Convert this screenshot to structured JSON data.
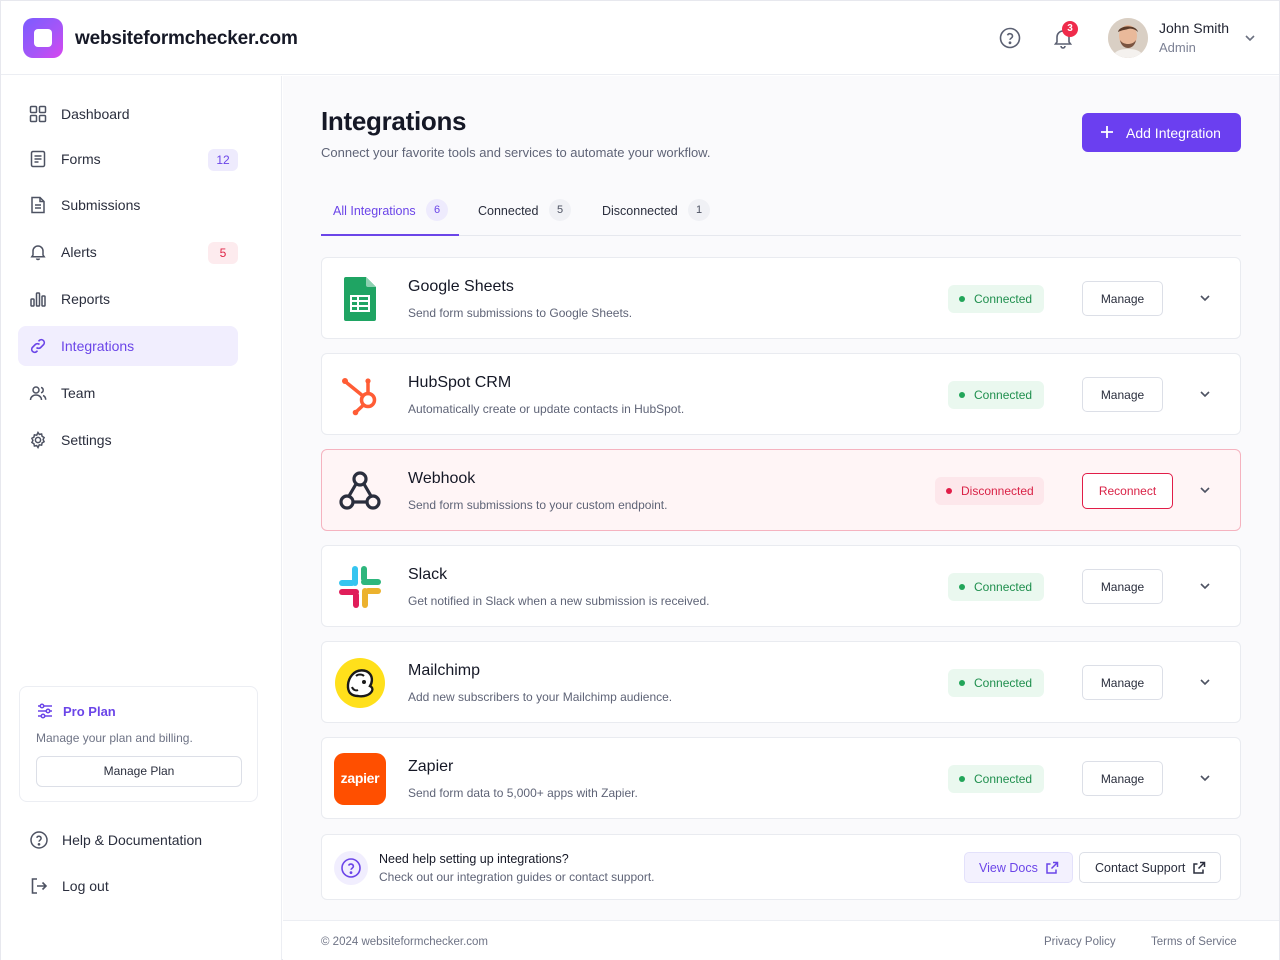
{
  "header": {
    "brand": "websiteformchecker.com",
    "notifications_count": "3",
    "user_name": "John Smith",
    "user_role": "Admin"
  },
  "sidebar": {
    "items": [
      {
        "label": "Dashboard",
        "count": ""
      },
      {
        "label": "Forms",
        "count": "12"
      },
      {
        "label": "Submissions",
        "count": ""
      },
      {
        "label": "Alerts",
        "count": "5"
      },
      {
        "label": "Reports",
        "count": ""
      },
      {
        "label": "Integrations",
        "count": ""
      },
      {
        "label": "Team",
        "count": ""
      },
      {
        "label": "Settings",
        "count": ""
      }
    ],
    "plan": {
      "title": "Pro Plan",
      "desc": "Manage your plan and billing.",
      "button": "Manage Plan"
    },
    "help_label": "Help & Documentation",
    "logout_label": "Log out"
  },
  "main": {
    "title": "Integrations",
    "subtitle": "Connect your favorite tools and services to automate your workflow.",
    "add_button": "Add Integration",
    "tabs": [
      {
        "label": "All Integrations",
        "count": "6"
      },
      {
        "label": "Connected",
        "count": "5"
      },
      {
        "label": "Disconnected",
        "count": "1"
      }
    ],
    "integrations": [
      {
        "name": "Google Sheets",
        "desc": "Send form submissions to Google Sheets.",
        "status": "Connected",
        "action": "Manage"
      },
      {
        "name": "HubSpot CRM",
        "desc": "Automatically create or update contacts in HubSpot.",
        "status": "Connected",
        "action": "Manage"
      },
      {
        "name": "Webhook",
        "desc": "Send form submissions to your custom endpoint.",
        "status": "Disconnected",
        "action": "Reconnect"
      },
      {
        "name": "Slack",
        "desc": "Get notified in Slack when a new submission is received.",
        "status": "Connected",
        "action": "Manage"
      },
      {
        "name": "Mailchimp",
        "desc": "Add new subscribers to your Mailchimp audience.",
        "status": "Connected",
        "action": "Manage"
      },
      {
        "name": "Zapier",
        "desc": "Send form data to 5,000+ apps with Zapier.",
        "status": "Connected",
        "action": "Manage"
      }
    ],
    "zapier_logo_text": "zapier",
    "help": {
      "title": "Need help setting up integrations?",
      "subtitle": "Check out our integration guides or contact support.",
      "docs_button": "View Docs",
      "support_button": "Contact Support"
    }
  },
  "footer": {
    "copyright": "© 2024 websiteformchecker.com",
    "privacy": "Privacy Policy",
    "terms": "Terms of Service"
  },
  "colors": {
    "accent": "#6b3ff0",
    "connected": "#22a559",
    "disconnected": "#e11d48"
  }
}
